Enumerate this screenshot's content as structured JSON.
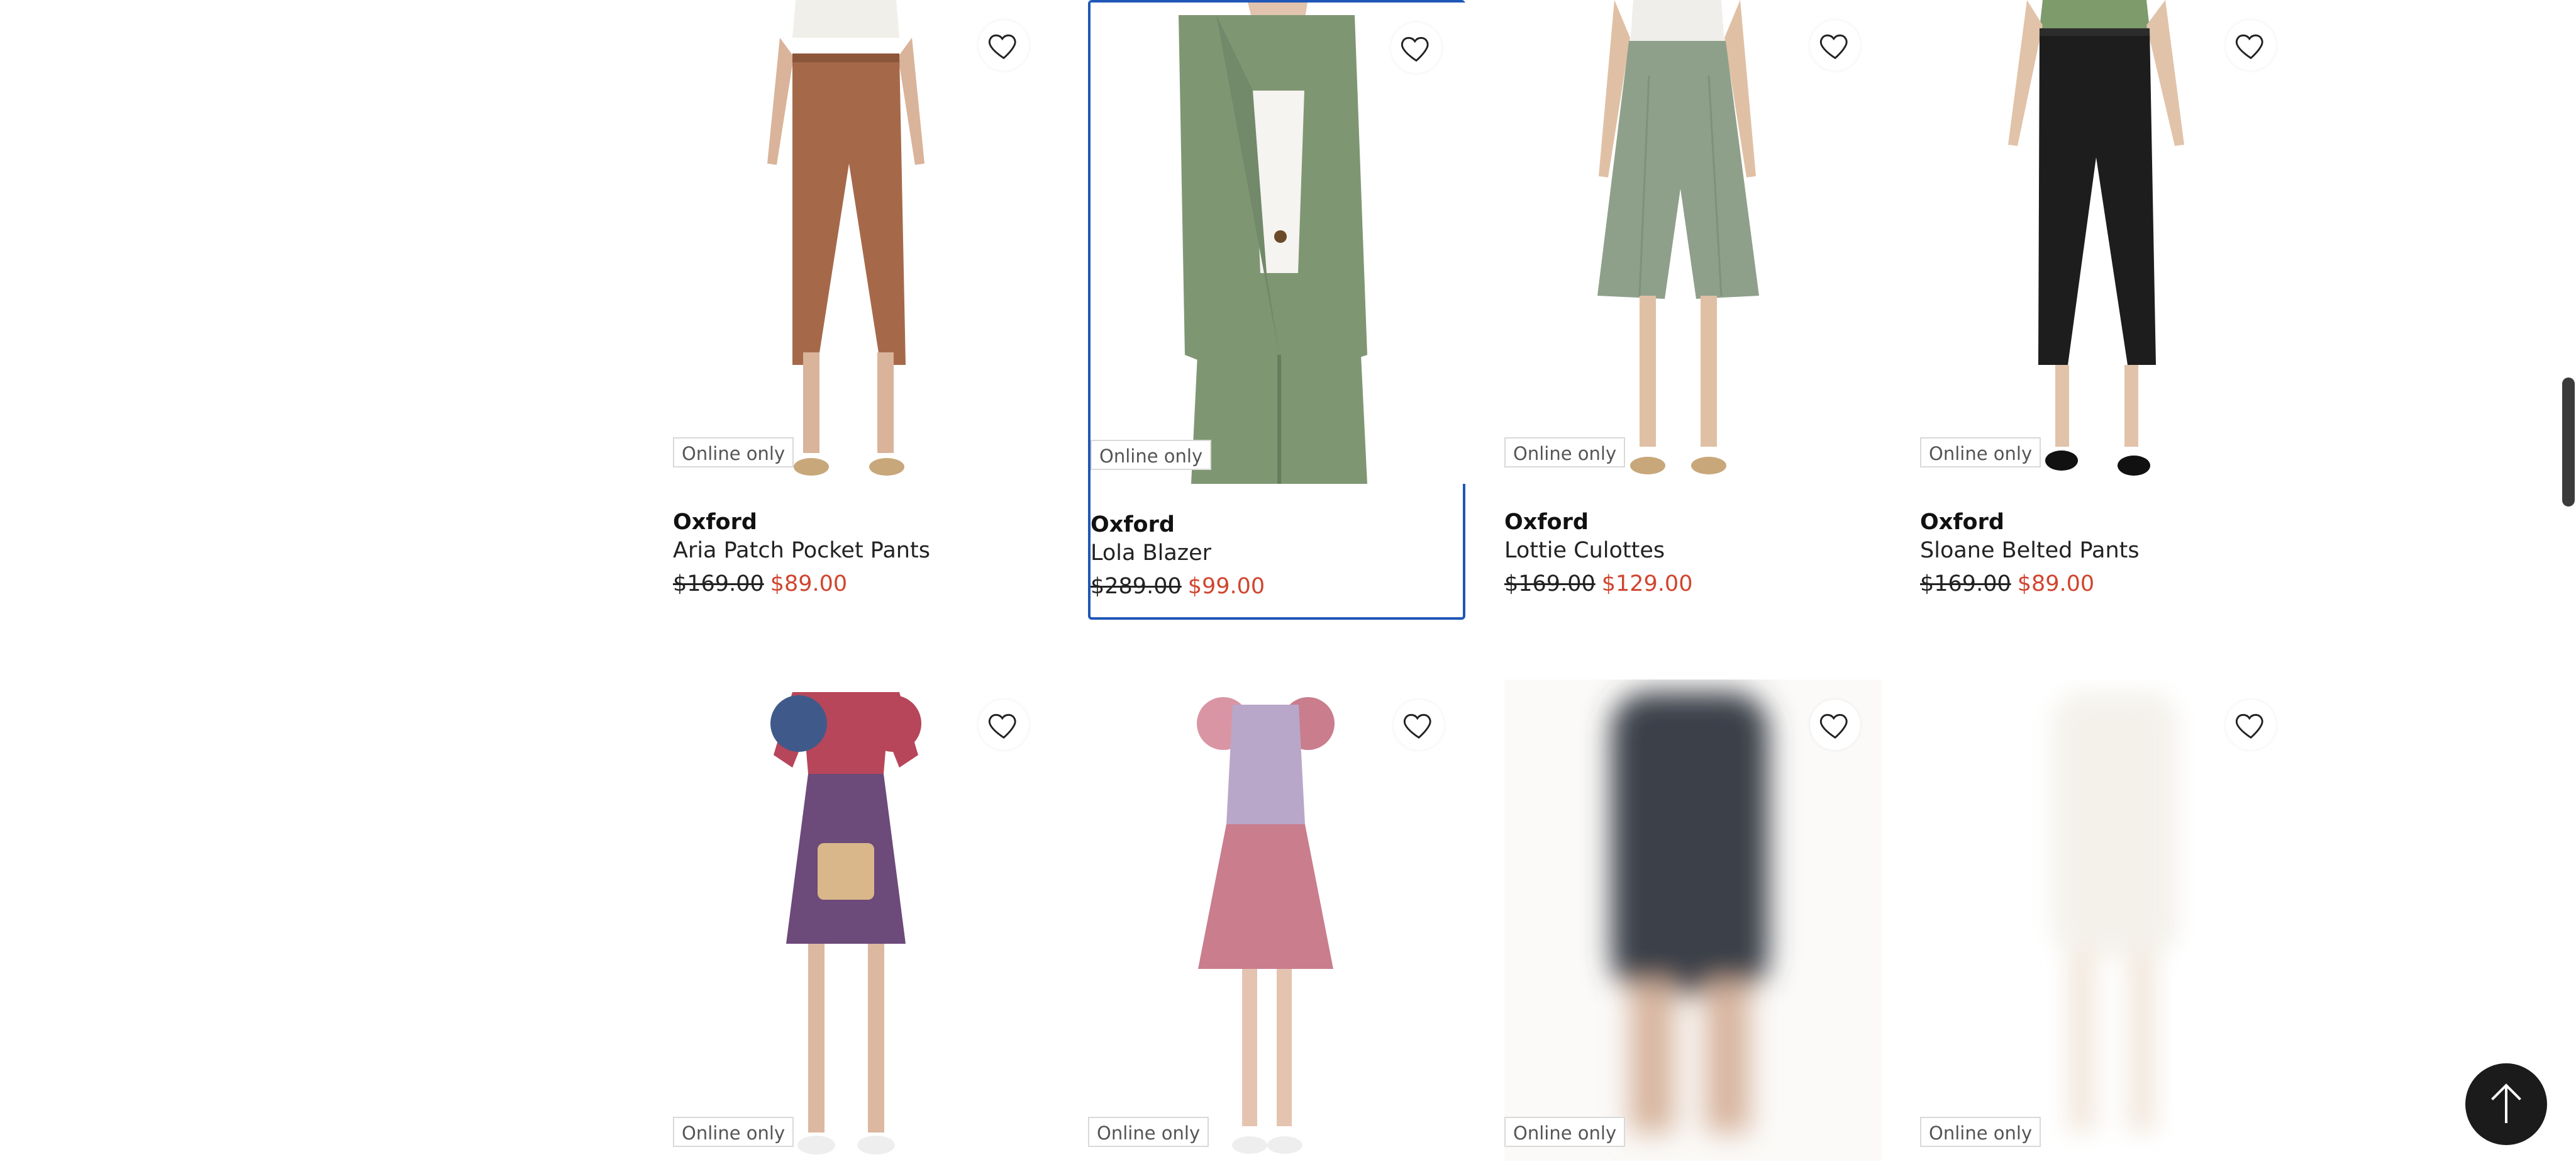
{
  "products": [
    {
      "brand": "Oxford",
      "name": "Aria Patch Pocket Pants",
      "was_price": "$169.00",
      "price": "$89.00",
      "badge": "Online only",
      "image_colors": {
        "top": "#f1efe9",
        "garment": "#a5694a",
        "skin": "#d9b39a",
        "shoes": "#c8a77a"
      }
    },
    {
      "brand": "Oxford",
      "name": "Lola Blazer",
      "was_price": "$289.00",
      "price": "$99.00",
      "badge": "Online only",
      "image_colors": {
        "top": "#f5f4f1",
        "garment": "#7f9673",
        "skin": "#e2c3ad",
        "shoes": "#7f9673"
      }
    },
    {
      "brand": "Oxford",
      "name": "Lottie Culottes",
      "was_price": "$169.00",
      "price": "$129.00",
      "badge": "Online only",
      "image_colors": {
        "top": "#efeeea",
        "garment": "#8ea08a",
        "skin": "#e0c0a5",
        "shoes": "#c8a77a"
      }
    },
    {
      "brand": "Oxford",
      "name": "Sloane Belted Pants",
      "was_price": "$169.00",
      "price": "$89.00",
      "badge": "Online only",
      "image_colors": {
        "top": "#7d9b6b",
        "garment": "#1d1d1d",
        "skin": "#e1c3aa",
        "shoes": "#111111"
      }
    },
    {
      "badge": "Online only",
      "image_colors": {
        "garment": "#b7465a",
        "skin": "#dcb8a0"
      }
    },
    {
      "badge": "Online only",
      "image_colors": {
        "garment": "#c97d8d",
        "skin": "#e4c4b0"
      }
    },
    {
      "badge": "Online only",
      "image_colors": {
        "garment": "#3a4149",
        "skin": "#d7b49d"
      }
    },
    {
      "badge": "Online only",
      "image_colors": {
        "garment": "#f2eee6",
        "skin": "#efe3d6"
      }
    }
  ],
  "colors": {
    "sale_price": "#d0452f",
    "selected_border": "#1f57b8"
  }
}
